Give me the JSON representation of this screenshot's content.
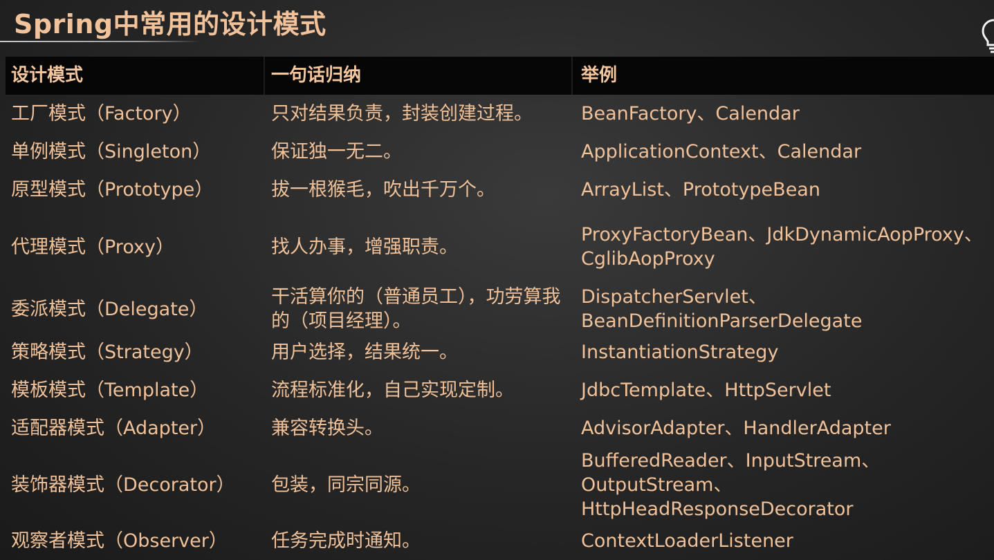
{
  "title": "Spring中常用的设计模式",
  "header": {
    "pattern": "设计模式",
    "summary": "一句话归纳",
    "example": "举例"
  },
  "rows": [
    {
      "pattern": "工厂模式（Factory）",
      "summary": "只对结果负责，封装创建过程。",
      "example": "BeanFactory、Calendar"
    },
    {
      "pattern": "单例模式（Singleton）",
      "summary": "保证独一无二。",
      "example": "ApplicationContext、Calendar"
    },
    {
      "pattern": "原型模式（Prototype）",
      "summary": "拔一根猴毛，吹出千万个。",
      "example": "ArrayList、PrototypeBean"
    },
    {
      "pattern": "代理模式（Proxy）",
      "summary": "找人办事，增强职责。",
      "example": "ProxyFactoryBean、JdkDynamicAopProxy、CglibAopProxy"
    },
    {
      "pattern": "委派模式（Delegate）",
      "summary": "干活算你的（普通员工），功劳算我的（项目经理）。",
      "example": "DispatcherServlet、BeanDefinitionParserDelegate"
    },
    {
      "pattern": "策略模式（Strategy）",
      "summary": "用户选择，结果统一。",
      "example": "InstantiationStrategy"
    },
    {
      "pattern": "模板模式（Template）",
      "summary": "流程标准化，自己实现定制。",
      "example": "JdbcTemplate、HttpServlet"
    },
    {
      "pattern": "适配器模式（Adapter）",
      "summary": "兼容转换头。",
      "example": "AdvisorAdapter、HandlerAdapter"
    },
    {
      "pattern": "装饰器模式（Decorator）",
      "summary": "包装，同宗同源。",
      "example": "BufferedReader、InputStream、OutputStream、HttpHeadResponseDecorator"
    },
    {
      "pattern": "观察者模式（Observer）",
      "summary": "任务完成时通知。",
      "example": "ContextLoaderListener"
    }
  ],
  "icons": {
    "corner": "lightbulb-icon"
  },
  "colors": {
    "text": "#f1c299",
    "header_background": "#060606"
  }
}
